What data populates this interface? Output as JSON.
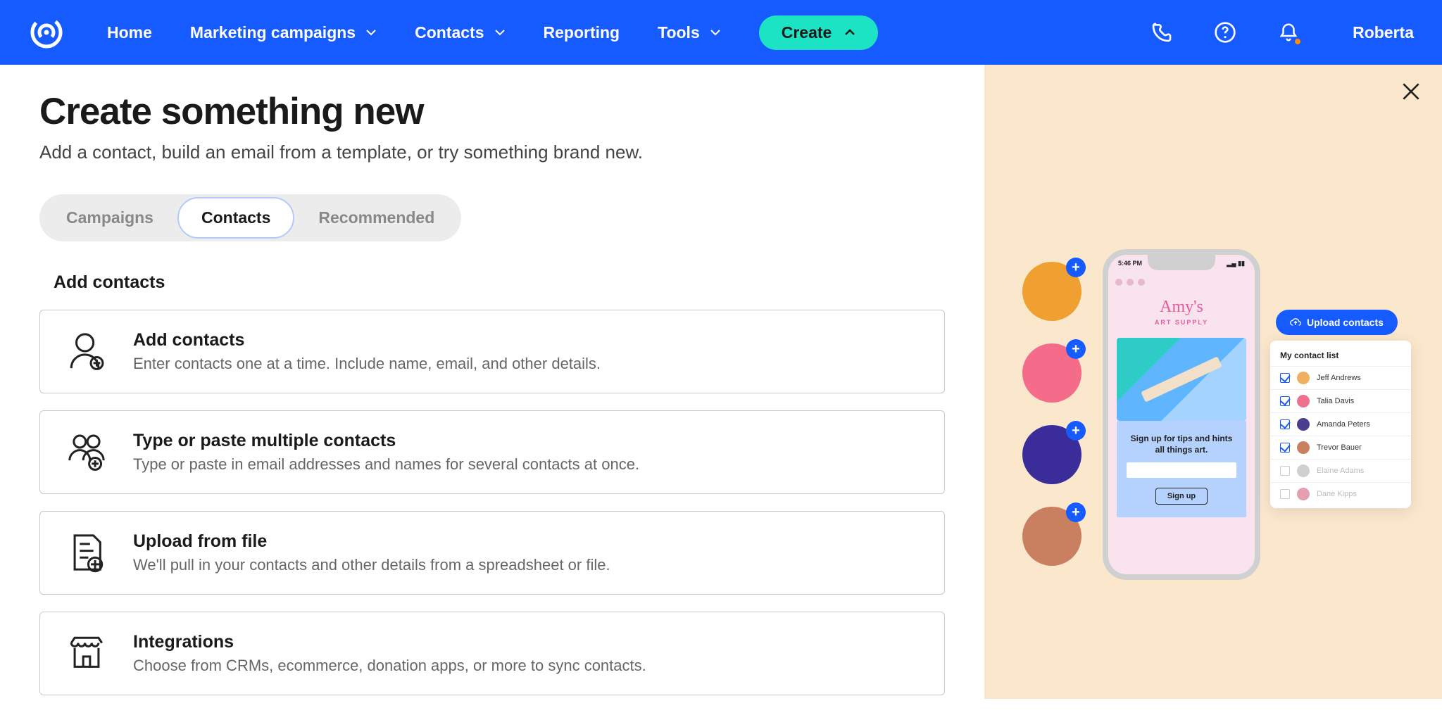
{
  "nav": {
    "home": "Home",
    "campaigns": "Marketing campaigns",
    "contacts": "Contacts",
    "reporting": "Reporting",
    "tools": "Tools",
    "create": "Create",
    "user": "Roberta"
  },
  "page": {
    "title": "Create something new",
    "subtitle": "Add a contact, build an email from a template, or try something brand new."
  },
  "tabs": {
    "campaigns": "Campaigns",
    "contacts": "Contacts",
    "recommended": "Recommended"
  },
  "section_heading": "Add contacts",
  "cards": {
    "add": {
      "title": "Add contacts",
      "desc": "Enter contacts one at a time. Include name, email, and other details."
    },
    "multi": {
      "title": "Type or paste multiple contacts",
      "desc": "Type or paste in email addresses and names for several contacts at once."
    },
    "upload": {
      "title": "Upload from file",
      "desc": "We'll pull in your contacts and other details from a spreadsheet or file."
    },
    "integrations": {
      "title": "Integrations",
      "desc": "Choose from CRMs, ecommerce, donation apps, or more to sync contacts."
    }
  },
  "sidebar": {
    "phone": {
      "time": "5:46 PM",
      "brand_l1": "Amy's",
      "brand_l2": "ART SUPPLY",
      "banner": "Sign up for tips and hints all things art.",
      "signup": "Sign up"
    },
    "upload_btn": "Upload contacts",
    "list_title": "My contact list",
    "contacts": [
      {
        "name": "Jeff Andrews",
        "checked": true,
        "color": "#f0b060"
      },
      {
        "name": "Talia Davis",
        "checked": true,
        "color": "#f07090"
      },
      {
        "name": "Amanda Peters",
        "checked": true,
        "color": "#4d3d8f"
      },
      {
        "name": "Trevor Bauer",
        "checked": true,
        "color": "#c98060"
      },
      {
        "name": "Elaine Adams",
        "checked": false,
        "color": "#d0d0d0"
      },
      {
        "name": "Dane Kipps",
        "checked": false,
        "color": "#e4a0b0"
      }
    ],
    "avatar_colors": [
      "#f0a030",
      "#f56b8a",
      "#3a2d99",
      "#c98060"
    ]
  }
}
